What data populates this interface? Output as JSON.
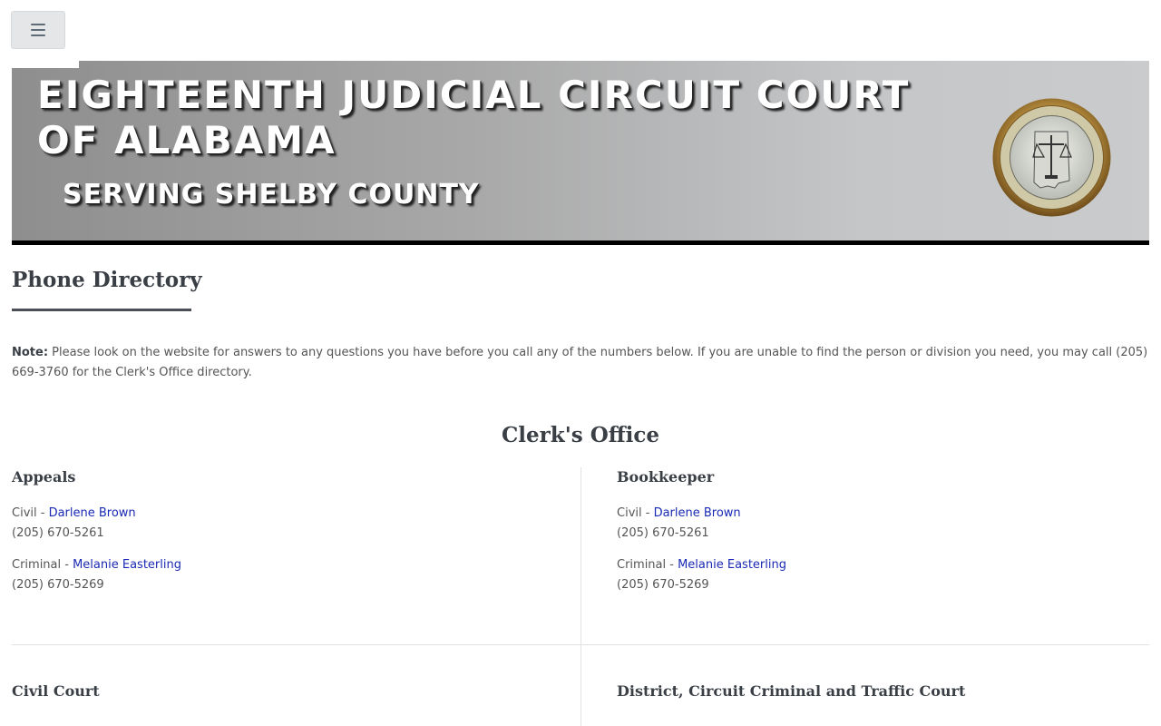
{
  "header": {
    "title": "EIGHTEENTH JUDICIAL CIRCUIT COURT OF ALABAMA",
    "subtitle": "SERVING SHELBY COUNTY",
    "seal_icon": "unified-judicial-system-seal",
    "seal_text": "UNIFIED JUDICIAL SYSTEM STATE OF ALABAMA TENNESSEE GEORGIA MISSISSIPPI FLORIDA A.D. 1971"
  },
  "page": {
    "heading": "Phone Directory",
    "note_label": "Note:",
    "note_text": " Please look on the website for answers to any questions you have before you call any of the numbers below. If you are unable to find the person or division you need, you may call (205) 669-3760 for the Clerk's Office directory."
  },
  "section": {
    "title": "Clerk's Office",
    "cards": [
      {
        "title": "Appeals",
        "entries": [
          {
            "prefix": "Civil - ",
            "name": "Darlene Brown",
            "phone": "(205) 670-5261"
          },
          {
            "prefix": "Criminal - ",
            "name": "Melanie Easterling",
            "phone": "(205) 670-5269"
          }
        ]
      },
      {
        "title": "Bookkeeper",
        "entries": [
          {
            "prefix": "Civil - ",
            "name": "Darlene Brown",
            "phone": "(205) 670-5261"
          },
          {
            "prefix": "Criminal - ",
            "name": "Melanie Easterling",
            "phone": "(205) 670-5269"
          }
        ]
      },
      {
        "title": "Civil Court",
        "entries": []
      },
      {
        "title": "District, Circuit Criminal and Traffic Court",
        "entries": []
      }
    ]
  },
  "colors": {
    "link": "#1a2ab4",
    "heading": "#3a3f46",
    "text": "#555555"
  }
}
